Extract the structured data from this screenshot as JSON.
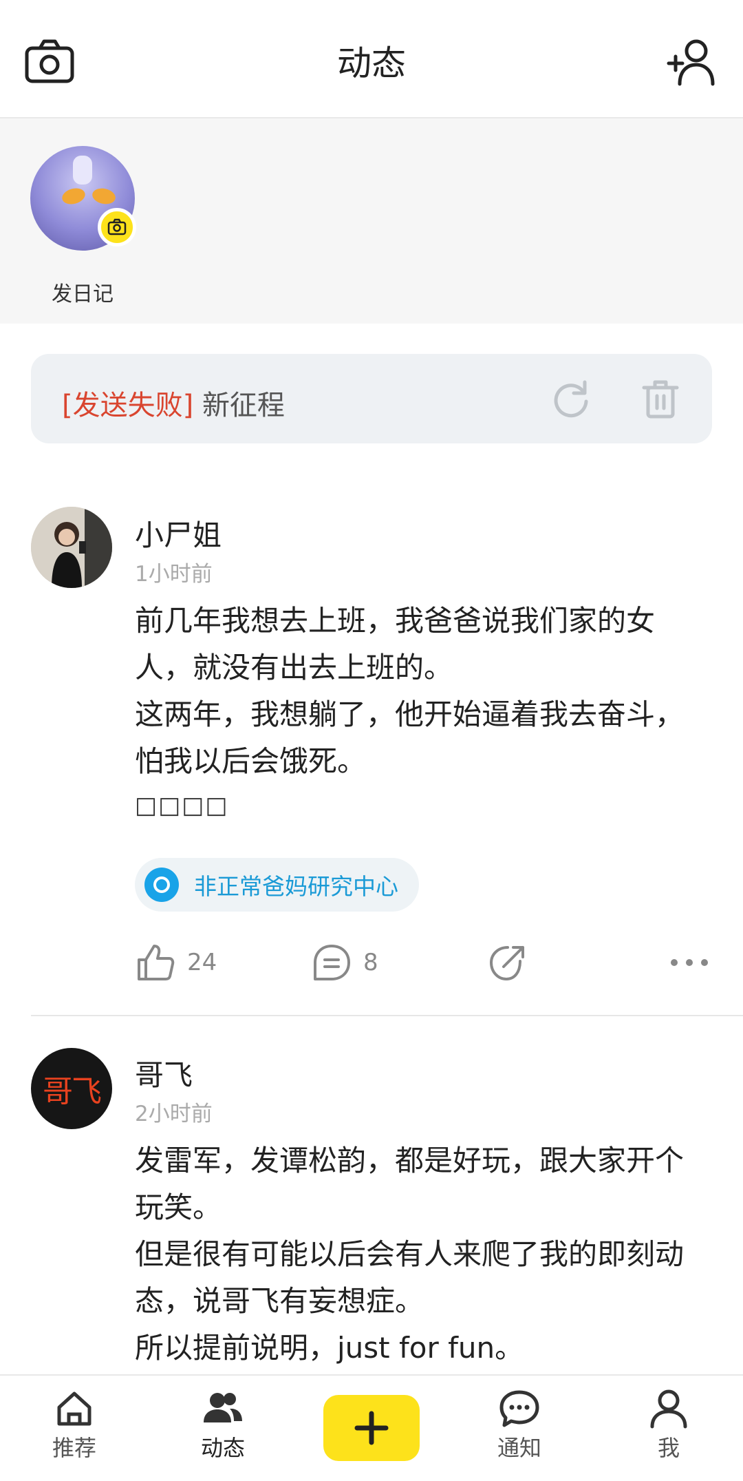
{
  "header": {
    "title": "动态",
    "left_icon": "camera-icon",
    "right_icon": "add-friend-icon"
  },
  "diary": {
    "label": "发日记",
    "badge_icon": "camera-icon"
  },
  "failed_draft": {
    "tag": "[发送失败]",
    "text": "新征程",
    "actions": [
      "refresh-icon",
      "trash-icon"
    ]
  },
  "posts": [
    {
      "name": "小尸姐",
      "time": "1小时前",
      "lines": [
        "前几年我想去上班，我爸爸说我们家的女",
        "人，就没有出去上班的。",
        "这两年，我想躺了，他开始逼着我去奋斗，",
        "怕我以后会饿死。"
      ],
      "boxes": "□□□□",
      "topic": "非正常爸妈研究中心",
      "likes": "24",
      "comments": "8"
    },
    {
      "name": "哥飞",
      "avatar_text": "哥飞",
      "time": "2小时前",
      "lines": [
        "发雷军，发谭松韵，都是好玩，跟大家开个",
        "玩笑。",
        "但是很有可能以后会有人来爬了我的即刻动",
        "态，说哥飞有妄想症。",
        "所以提前说明，just for fun。"
      ]
    }
  ],
  "bottom_nav": {
    "items": [
      {
        "label": "推荐",
        "icon": "home-icon"
      },
      {
        "label": "动态",
        "icon": "people-icon",
        "active": true
      },
      {
        "label": "通知",
        "icon": "chat-bubble-icon"
      },
      {
        "label": "我",
        "icon": "person-icon"
      }
    ],
    "center_icon": "plus-icon"
  },
  "colors": {
    "accent_yellow": "#FDE21B",
    "error_red": "#D9452F",
    "topic_blue": "#1A9AD6"
  }
}
